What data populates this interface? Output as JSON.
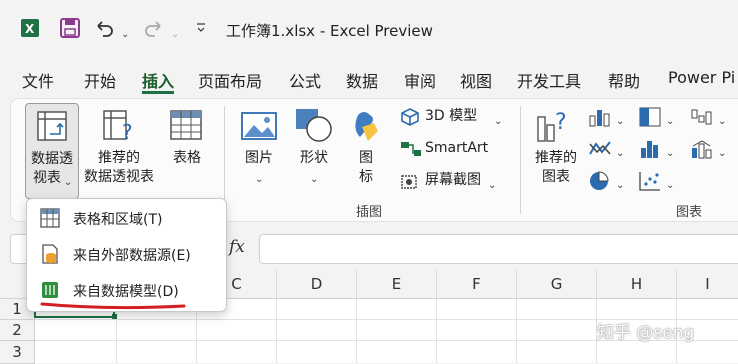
{
  "window": {
    "title": "工作簿1.xlsx  -  Excel Preview"
  },
  "tabs": [
    {
      "label": "文件"
    },
    {
      "label": "开始"
    },
    {
      "label": "插入"
    },
    {
      "label": "页面布局"
    },
    {
      "label": "公式"
    },
    {
      "label": "数据"
    },
    {
      "label": "审阅"
    },
    {
      "label": "视图"
    },
    {
      "label": "开发工具"
    },
    {
      "label": "帮助"
    },
    {
      "label": "Power Pi"
    }
  ],
  "ribbon": {
    "pivot_table": {
      "line1": "数据透",
      "line2": "视表"
    },
    "recommended_pivot": {
      "line1": "推荐的",
      "line2": "数据透视表"
    },
    "table": {
      "label": "表格"
    },
    "pictures": {
      "label": "图片"
    },
    "shapes": {
      "label": "形状"
    },
    "icons": {
      "line1": "图",
      "line2": "标"
    },
    "models_3d": {
      "label": "3D 模型"
    },
    "smartart": {
      "label": "SmartArt"
    },
    "screenshot": {
      "label": "屏幕截图"
    },
    "recommended_charts": {
      "line1": "推荐的",
      "line2": "图表"
    },
    "illustrations_group": "插图",
    "charts_group": "图表"
  },
  "formula_bar": {
    "fx": "fx"
  },
  "grid": {
    "columns": [
      "C",
      "D",
      "E",
      "F",
      "G",
      "H",
      "I"
    ],
    "rows": [
      "1",
      "2",
      "3"
    ]
  },
  "dropdown": {
    "items": [
      {
        "label": "表格和区域(T)",
        "icon": "table-icon"
      },
      {
        "label": "来自外部数据源(E)",
        "icon": "external-data-icon"
      },
      {
        "label": "来自数据模型(D)",
        "icon": "data-model-icon"
      }
    ]
  },
  "watermark": "知乎 @seng",
  "colors": {
    "accent_green": "#1e7145",
    "annotation_red": "#d22020"
  }
}
